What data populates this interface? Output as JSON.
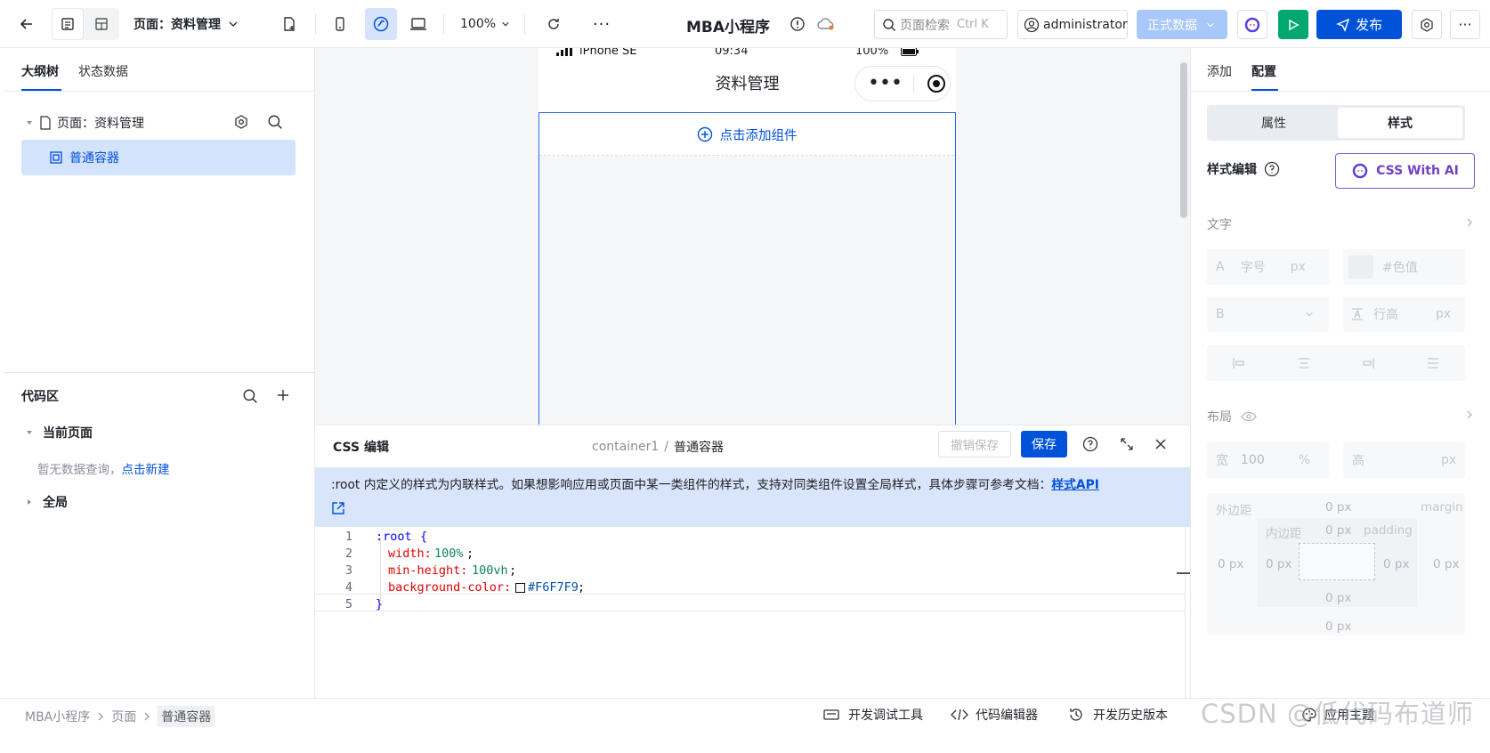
{
  "topbar": {
    "page_select": "页面：资料管理",
    "zoom": "100%",
    "app_title": "MBA小程序",
    "search_placeholder": "页面检索",
    "search_shortcut": "Ctrl K",
    "user": "administrator",
    "env_button": "正式数据",
    "publish_button": "发布"
  },
  "left": {
    "tab_outline": "大纲树",
    "tab_state": "状态数据",
    "tree_page": "页面：资料管理",
    "tree_container": "普通容器",
    "code_title": "代码区",
    "current_page": "当前页面",
    "empty_text": "暂无数据查询，",
    "create_link": "点击新建",
    "global": "全局"
  },
  "phone": {
    "carrier": "iPhone SE",
    "time": "09:34",
    "battery": "100%",
    "nav_title": "资料管理",
    "add_component": "点击添加组件"
  },
  "editor": {
    "title": "CSS 编辑",
    "crumb_parent": "container1",
    "crumb_sep": "/",
    "crumb_current": "普通容器",
    "undo_save": "撤销保存",
    "save": "保存",
    "notice": ":root 内定义的样式为内联样式。如果想影响应用或页面中某一类组件的样式，支持对同类组件设置全局样式，具体步骤可参考文档：",
    "notice_link": "样式API",
    "code": {
      "line_numbers": [
        "1",
        "2",
        "3",
        "4",
        "5"
      ],
      "l1_selector": ":root",
      "l1_brace": "{",
      "l2_prop": "width:",
      "l2_val": "100%",
      "l3_prop": "min-height:",
      "l3_val": "100vh",
      "l4_prop": "background-color:",
      "l4_val": "#F6F7F9",
      "semicolon": ";",
      "l5_brace": "}"
    }
  },
  "right": {
    "tab_add": "添加",
    "tab_config": "配置",
    "seg_props": "属性",
    "seg_style": "样式",
    "style_edit": "样式编辑",
    "css_ai": "CSS With AI",
    "text_section": "文字",
    "font_size_prefix": "A",
    "font_size_placeholder": "字号",
    "px": "px",
    "color_placeholder": "#色值",
    "weight_prefix": "B",
    "line_height_placeholder": "行高",
    "layout_section": "布局",
    "width_label": "宽",
    "width_value": "100",
    "width_unit": "%",
    "height_label": "高",
    "margin_label": "外边距",
    "margin_en": "margin",
    "padding_label": "内边距",
    "padding_en": "padding",
    "zero_px": "0 px"
  },
  "statusbar": {
    "crumb1": "MBA小程序",
    "crumb2": "页面",
    "crumb3": "普通容器",
    "devtools": "开发调试工具",
    "code_editor": "代码编辑器",
    "history": "开发历史版本",
    "theme": "应用主题",
    "watermark": "CSDN @低代码布道师"
  },
  "colors": {
    "primary": "#0052d9",
    "env_disabled": "#a8c7fa",
    "run_green": "#00a870",
    "selected_row": "#d4e3fc",
    "notice_bg": "#d9e5fa",
    "ai_purple": "#6f42c1"
  }
}
